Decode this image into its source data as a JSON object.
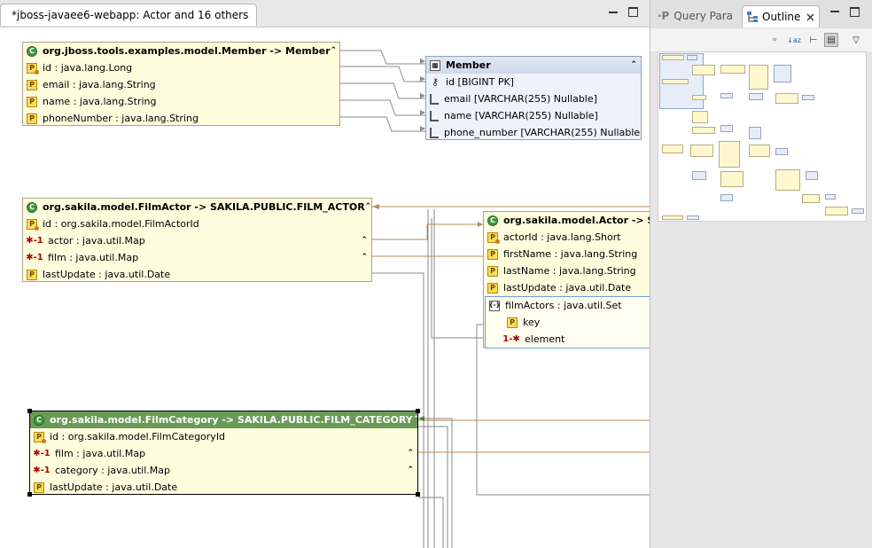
{
  "editor": {
    "tab_title": "*jboss-javaee6-webapp: Actor and 16 others",
    "tab_icon": "diagram-icon"
  },
  "diagram": {
    "member_entity": {
      "title": "org.jboss.tools.examples.model.Member -> Member",
      "rows": [
        "id : java.lang.Long",
        "email : java.lang.String",
        "name : java.lang.String",
        "phoneNumber : java.lang.String"
      ]
    },
    "member_table": {
      "title": "Member",
      "rows": [
        "id [BIGINT PK]",
        "email [VARCHAR(255) Nullable]",
        "name [VARCHAR(255) Nullable]",
        "phone_number [VARCHAR(255) Nullable]"
      ]
    },
    "filmactor_entity": {
      "title": "org.sakila.model.FilmActor -> SAKILA.PUBLIC.FILM_ACTOR",
      "rows": [
        "id : org.sakila.model.FilmActorId",
        "actor : java.util.Map",
        "film : java.util.Map",
        "lastUpdate : java.util.Date"
      ]
    },
    "actor_entity": {
      "title": "org.sakila.model.Actor -> SA",
      "rows": [
        "actorId : java.lang.Short",
        "firstName : java.lang.String",
        "lastName : java.lang.String",
        "lastUpdate : java.util.Date"
      ],
      "collection": {
        "label": "filmActors : java.util.Set",
        "children": [
          "key",
          "element"
        ]
      }
    },
    "filmcategory_entity": {
      "title": "org.sakila.model.FilmCategory -> SAKILA.PUBLIC.FILM_CATEGORY",
      "rows": [
        "id : org.sakila.model.FilmCategoryId",
        "film : java.util.Map",
        "category : java.util.Map",
        "lastUpdate : java.util.Date"
      ]
    }
  },
  "side": {
    "query_tab": "Query Para",
    "outline_tab": "Outline"
  },
  "colors": {
    "entity_fill": "#fffdde",
    "table_fill": "#eef2fa",
    "selected_header": "#6a9a57",
    "wire_gray": "#8a8a8a",
    "wire_tan": "#b58a5a"
  }
}
